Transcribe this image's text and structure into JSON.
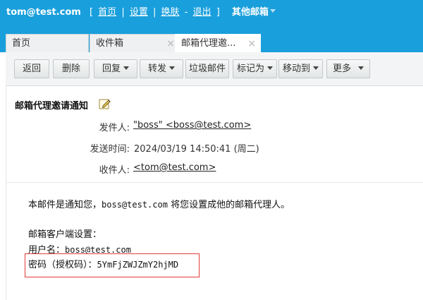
{
  "header": {
    "user": "tom@test.com",
    "bracket_open": "[",
    "links": [
      "首页",
      "设置",
      "换肤",
      "退出"
    ],
    "bar": "|",
    "dash": "-",
    "bracket_close": "]",
    "other_mail": "其他邮箱",
    "bar_color": "#199fdc"
  },
  "tabs": [
    {
      "label": "首页",
      "active": false,
      "closable": false
    },
    {
      "label": "收件箱",
      "active": false,
      "closable": true
    },
    {
      "label": "邮箱代理邀...",
      "active": true,
      "closable": true
    }
  ],
  "toolbar": {
    "back": "返回",
    "delete": "删除",
    "reply": "回复",
    "forward": "转发",
    "spam": "垃圾邮件",
    "mark": "标记为",
    "move": "移动到",
    "more": "更多"
  },
  "mail": {
    "subject": "邮箱代理邀请通知",
    "from_label": "发件人:",
    "from_value": "\"boss\" <boss@test.com>",
    "time_label": "发送时间:",
    "time_value": "2024/03/19 14:50:41 (周二)",
    "to_label": "收件人:",
    "to_value": "<tom@test.com>"
  },
  "body": {
    "line1_a": "本邮件是通知您，",
    "line1_email": "boss@test.com",
    "line1_b": " 将您设置成他的邮箱代理人。",
    "client_settings": "邮箱客户端设置：",
    "username_label": "用户名：",
    "username_value": "boss@test.com",
    "password_label": "密码（授权码）：",
    "password_value": "5YmFjZWJZmY2hjMD",
    "highlight_color": "#e23b3b"
  },
  "icons": {
    "close": "close-icon",
    "edit": "edit-icon",
    "dropdown": "chevron-down-icon"
  }
}
